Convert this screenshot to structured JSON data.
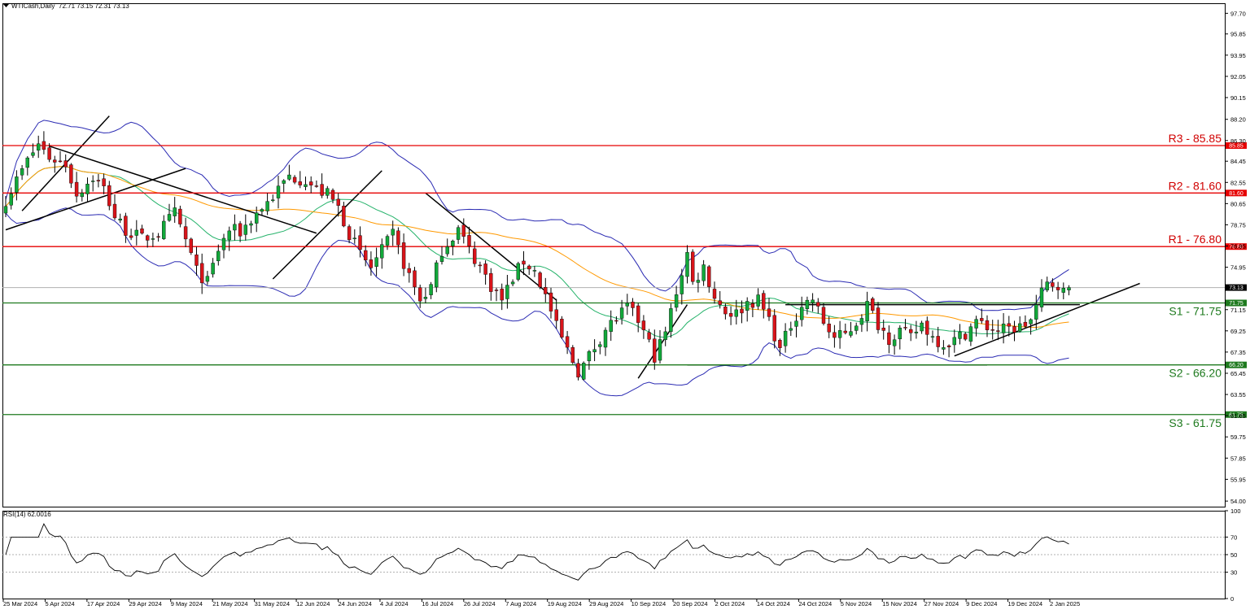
{
  "header": {
    "symbol_label": "WTICash,Daily",
    "ohlc": "72.71 73.15 72.31 73.13"
  },
  "rsi_header": "RSI(14) 62.0016",
  "colors": {
    "candle_up": "#12a83a",
    "candle_down": "#d8141a",
    "resistance": "#e60000",
    "support": "#1e7a1e",
    "bollinger": "#2b2bb3",
    "ma_fast": "#26b36b",
    "ma_slow": "#ff9900",
    "rsi": "#000000",
    "price_tag": "#e60000",
    "current_price_tag": "#000000"
  },
  "chart_data": {
    "type": "candlestick",
    "symbol": "WTICash",
    "timeframe": "Daily",
    "price_axis": {
      "range": [
        53.5,
        98.6
      ],
      "ticks": [
        "97.70",
        "95.85",
        "93.95",
        "92.05",
        "90.15",
        "88.20",
        "86.30",
        "84.45",
        "82.55",
        "80.65",
        "78.75",
        "76.85",
        "74.95",
        "73.05",
        "71.15",
        "69.25",
        "67.35",
        "65.45",
        "63.55",
        "61.65",
        "59.75",
        "57.85",
        "55.95",
        "54.00"
      ]
    },
    "date_labels": [
      "25 Mar 2024",
      "5 Apr 2024",
      "17 Apr 2024",
      "29 Apr 2024",
      "9 May 2024",
      "21 May 2024",
      "31 May 2024",
      "12 Jun 2024",
      "24 Jun 2024",
      "4 Jul 2024",
      "16 Jul 2024",
      "26 Jul 2024",
      "7 Aug 2024",
      "19 Aug 2024",
      "29 Aug 2024",
      "10 Sep 2024",
      "20 Sep 2024",
      "2 Oct 2024",
      "14 Oct 2024",
      "24 Oct 2024",
      "5 Nov 2024",
      "15 Nov 2024",
      "27 Nov 2024",
      "9 Dec 2024",
      "19 Dec 2024",
      "2 Jan 2025"
    ],
    "levels": [
      {
        "name": "R3",
        "label": "R3 - 85.85",
        "tag": "85.85",
        "value": 85.85,
        "kind": "resistance"
      },
      {
        "name": "R2",
        "label": "R2 - 81.60",
        "tag": "81.60",
        "value": 81.6,
        "kind": "resistance"
      },
      {
        "name": "R1",
        "label": "R1 - 76.80",
        "tag": "76.80",
        "value": 76.8,
        "kind": "resistance"
      },
      {
        "name": "S1",
        "label": "S1 - 71.75",
        "tag": "71.75",
        "value": 71.75,
        "kind": "support"
      },
      {
        "name": "S2",
        "label": "S2 - 66.20",
        "tag": "66.20",
        "value": 66.2,
        "kind": "support"
      },
      {
        "name": "S3",
        "label": "S3 - 61.75",
        "tag": "61.75",
        "value": 61.75,
        "kind": "support"
      }
    ],
    "current_price": {
      "value": 73.13,
      "tag": "73.13"
    },
    "close_path": [
      [
        0,
        81.0
      ],
      [
        4,
        84.5
      ],
      [
        6,
        86.0
      ],
      [
        8,
        84.8
      ],
      [
        11,
        84.2
      ],
      [
        13,
        81.5
      ],
      [
        16,
        83.0
      ],
      [
        18,
        82.0
      ],
      [
        20,
        79.5
      ],
      [
        22,
        78.3
      ],
      [
        25,
        77.5
      ],
      [
        28,
        78.0
      ],
      [
        31,
        79.8
      ],
      [
        33,
        77.4
      ],
      [
        35,
        74.6
      ],
      [
        37,
        73.6
      ],
      [
        39,
        76.5
      ],
      [
        41,
        78.3
      ],
      [
        43,
        78.1
      ],
      [
        46,
        79.8
      ],
      [
        49,
        81.3
      ],
      [
        52,
        83.1
      ],
      [
        55,
        82.8
      ],
      [
        57,
        81.9
      ],
      [
        59,
        81.5
      ],
      [
        61,
        80.3
      ],
      [
        63,
        78.0
      ],
      [
        65,
        76.1
      ],
      [
        67,
        74.9
      ],
      [
        69,
        76.4
      ],
      [
        71,
        77.9
      ],
      [
        73,
        75.3
      ],
      [
        76,
        72.0
      ],
      [
        78,
        73.2
      ],
      [
        80,
        76.5
      ],
      [
        83,
        78.4
      ],
      [
        85,
        76.5
      ],
      [
        87,
        75.0
      ],
      [
        89,
        73.3
      ],
      [
        91,
        72.0
      ],
      [
        93,
        74.0
      ],
      [
        95,
        75.5
      ],
      [
        97,
        74.6
      ],
      [
        99,
        72.4
      ],
      [
        101,
        69.6
      ],
      [
        103,
        67.5
      ],
      [
        105,
        65.6
      ],
      [
        106,
        66.2
      ],
      [
        108,
        67.8
      ],
      [
        110,
        69.4
      ],
      [
        112,
        70.4
      ],
      [
        114,
        71.3
      ],
      [
        116,
        70.2
      ],
      [
        118,
        68.1
      ],
      [
        119,
        67.0
      ],
      [
        121,
        69.1
      ],
      [
        123,
        72.8
      ],
      [
        124,
        74.5
      ],
      [
        125,
        76.2
      ],
      [
        126,
        73.5
      ],
      [
        128,
        75.0
      ],
      [
        130,
        72.3
      ],
      [
        132,
        71.0
      ],
      [
        134,
        70.8
      ],
      [
        136,
        71.8
      ],
      [
        138,
        72.0
      ],
      [
        140,
        70.3
      ],
      [
        142,
        67.5
      ],
      [
        144,
        69.8
      ],
      [
        146,
        71.6
      ],
      [
        148,
        72.1
      ],
      [
        150,
        70.0
      ],
      [
        152,
        68.6
      ],
      [
        154,
        68.9
      ],
      [
        156,
        70.0
      ],
      [
        158,
        71.6
      ],
      [
        160,
        69.9
      ],
      [
        162,
        68.6
      ],
      [
        164,
        69.3
      ],
      [
        166,
        68.6
      ],
      [
        168,
        69.9
      ],
      [
        170,
        68.7
      ],
      [
        172,
        68.1
      ],
      [
        174,
        68.4
      ],
      [
        176,
        69.1
      ],
      [
        178,
        70.1
      ],
      [
        180,
        69.6
      ],
      [
        182,
        69.3
      ],
      [
        184,
        69.4
      ],
      [
        186,
        69.6
      ],
      [
        188,
        70.2
      ],
      [
        189,
        71.4
      ],
      [
        190,
        72.6
      ],
      [
        191,
        73.4
      ],
      [
        193,
        73.5
      ],
      [
        194,
        72.7
      ],
      [
        195,
        73.13
      ]
    ],
    "overlays": [
      "Bollinger Bands (upper, lower)",
      "moving average (green)",
      "moving average (orange)"
    ],
    "rsi": {
      "period": 14,
      "value": 62.0016,
      "range": [
        0,
        100
      ],
      "ticks": [
        "100",
        "70",
        "50",
        "30",
        "0"
      ],
      "levels": [
        70,
        50,
        30
      ]
    },
    "grid": false
  }
}
